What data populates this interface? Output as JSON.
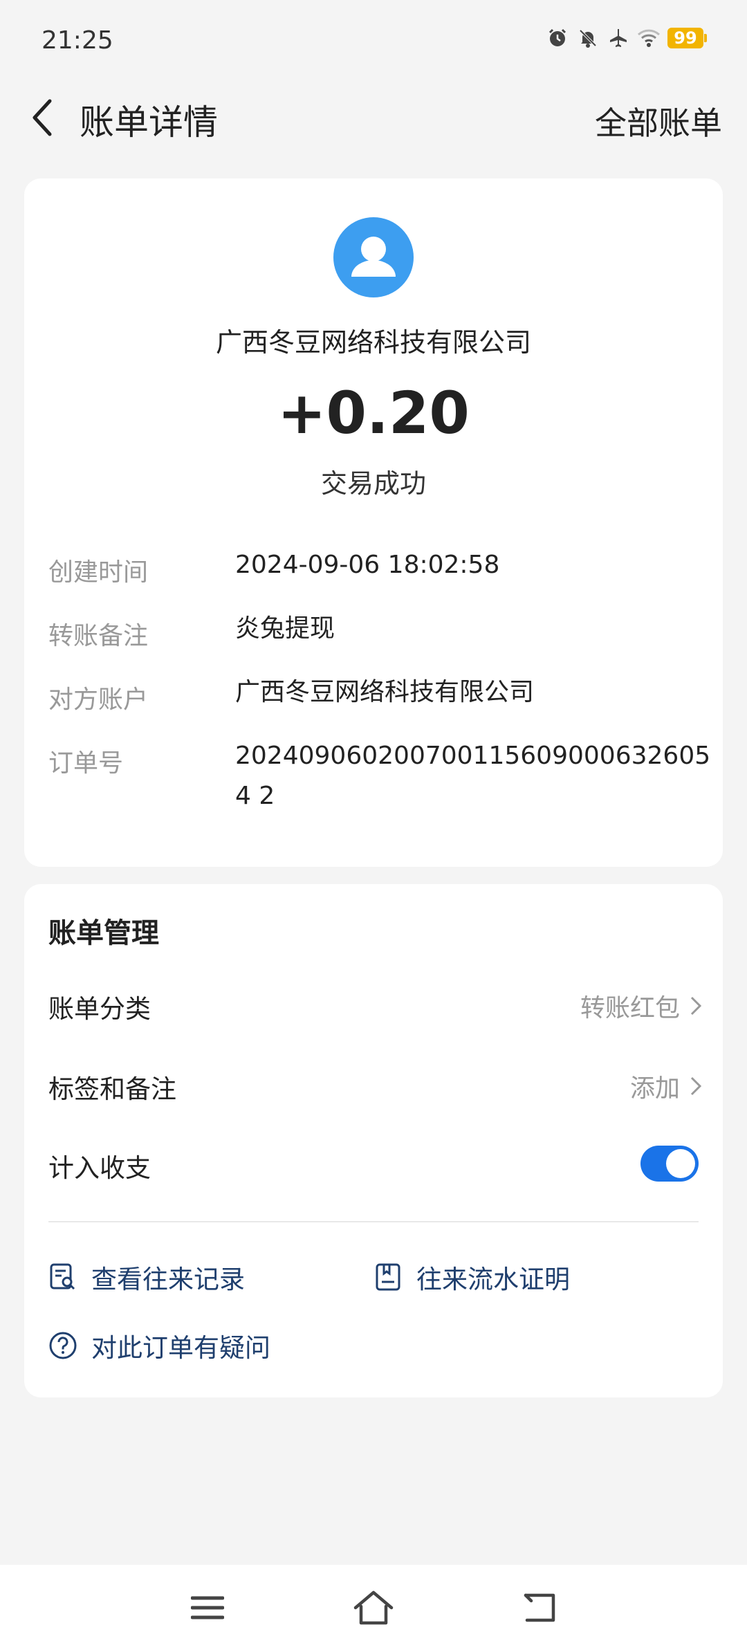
{
  "status_bar": {
    "time": "21:25",
    "battery": "99",
    "icons": [
      "alarm-icon",
      "bell-off-icon",
      "airplane-icon",
      "wifi-icon",
      "battery-icon"
    ]
  },
  "nav": {
    "title": "账单详情",
    "right_action": "全部账单"
  },
  "transaction": {
    "merchant": "广西冬豆网络科技有限公司",
    "amount": "+0.20",
    "status": "交易成功",
    "details": [
      {
        "label": "创建时间",
        "value": "2024-09-06 18:02:58"
      },
      {
        "label": "转账备注",
        "value": "炎兔提现"
      },
      {
        "label": "对方账户",
        "value": "广西冬豆网络科技有限公司"
      },
      {
        "label": "订单号",
        "value": "2024090602007001156090006326054 2"
      }
    ]
  },
  "management": {
    "title": "账单管理",
    "category_label": "账单分类",
    "category_value": "转账红包",
    "tag_label": "标签和备注",
    "tag_value": "添加",
    "income_label": "计入收支",
    "income_enabled": true,
    "links": {
      "records": "查看往来记录",
      "proof": "往来流水证明",
      "question": "对此订单有疑问"
    }
  },
  "colors": {
    "accent": "#1a73e8",
    "avatar": "#3d9ef0",
    "link_text": "#1f3f6e",
    "battery": "#f2b400"
  }
}
